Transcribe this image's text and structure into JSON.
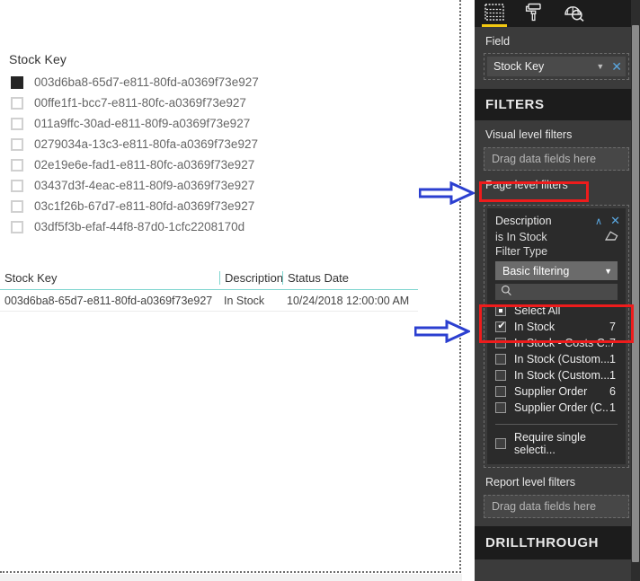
{
  "canvas": {
    "slicer": {
      "title": "Stock Key",
      "items": [
        {
          "label": "003d6ba8-65d7-e811-80fd-a0369f73e927",
          "selected": true
        },
        {
          "label": "00ffe1f1-bcc7-e811-80fc-a0369f73e927",
          "selected": false
        },
        {
          "label": "011a9ffc-30ad-e811-80f9-a0369f73e927",
          "selected": false
        },
        {
          "label": "0279034a-13c3-e811-80fa-a0369f73e927",
          "selected": false
        },
        {
          "label": "02e19e6e-fad1-e811-80fc-a0369f73e927",
          "selected": false
        },
        {
          "label": "03437d3f-4eac-e811-80f9-a0369f73e927",
          "selected": false
        },
        {
          "label": "03c1f26b-67d7-e811-80fd-a0369f73e927",
          "selected": false
        },
        {
          "label": "03df5f3b-efaf-44f8-87d0-1cfc2208170d",
          "selected": false
        }
      ]
    },
    "table": {
      "headers": [
        "Stock Key",
        "Description",
        "Status Date"
      ],
      "rows": [
        [
          "003d6ba8-65d7-e811-80fd-a0369f73e927",
          "In Stock",
          "10/24/2018 12:00:00 AM"
        ]
      ]
    }
  },
  "pane": {
    "iconbar": {
      "tabs": [
        {
          "name": "fields-tab",
          "icon": "fields-icon",
          "selected": true
        },
        {
          "name": "format-tab",
          "icon": "paint-roller-icon",
          "selected": false
        },
        {
          "name": "analytics-tab",
          "icon": "analytics-magnifier-icon",
          "selected": false
        }
      ]
    },
    "field_section": {
      "label": "Field",
      "pill": {
        "name": "Stock Key",
        "caret": "▼",
        "remove": "✕"
      }
    },
    "filters": {
      "heading": "FILTERS",
      "visual_level_label": "Visual level filters",
      "visual_level_drop": "Drag data fields here",
      "page_level_label": "Page level filters",
      "report_level_label": "Report level filters",
      "report_level_drop": "Drag data fields here",
      "card": {
        "title": "Description",
        "collapse": "∧",
        "close": "✕",
        "condition": "is In Stock",
        "clear_icon": "eraser-icon",
        "filter_type_label": "Filter Type",
        "filter_type_value": "Basic filtering",
        "filter_type_caret": "▼",
        "search_placeholder": "",
        "search_icon": "search-icon",
        "items": [
          {
            "label": "Select All",
            "count": "",
            "state": "partial"
          },
          {
            "label": "In Stock",
            "count": "7",
            "state": "checked"
          },
          {
            "label": "In Stock - Costs C...",
            "count": "7",
            "state": "unchecked"
          },
          {
            "label": "In Stock (Custom...",
            "count": "1",
            "state": "unchecked"
          },
          {
            "label": "In Stock (Custom...",
            "count": "1",
            "state": "unchecked"
          },
          {
            "label": "Supplier Order",
            "count": "6",
            "state": "unchecked"
          },
          {
            "label": "Supplier Order (C...",
            "count": "1",
            "state": "unchecked"
          }
        ],
        "require_single": "Require single selecti..."
      }
    },
    "drillthrough_heading": "DRILLTHROUGH"
  },
  "annotations": {
    "colors": {
      "highlight_box": "#ee1c1c",
      "arrow": "#2b3fd0",
      "accent_yellow": "#f2c811"
    },
    "arrows": [
      {
        "name": "arrow-page-level-filters",
        "target": "Page level filters"
      },
      {
        "name": "arrow-in-stock-checkbox",
        "target": "In Stock"
      }
    ]
  }
}
